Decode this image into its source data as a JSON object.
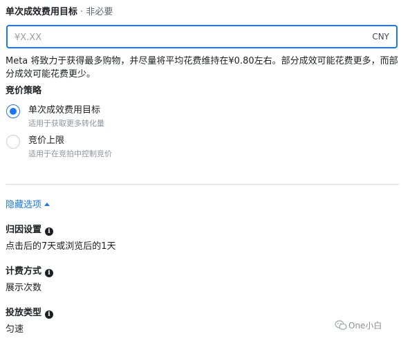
{
  "cost_goal": {
    "label": "单次成效费用目标",
    "optional_text": " · 非必要",
    "input_value": "",
    "placeholder": "¥X.XX",
    "currency": "CNY",
    "help_text": "Meta 将致力于获得最多购物，并尽量将平均花费维持在¥0.80左右。部分成效可能花费更多，而部分成效可能花费更少。"
  },
  "bid_strategy": {
    "title": "竞价策略",
    "options": [
      {
        "label": "单次成效费用目标",
        "description": "适用于获取更多转化量",
        "selected": true
      },
      {
        "label": "竞价上限",
        "description": "适用于在竞拍中控制竞价",
        "selected": false
      }
    ]
  },
  "hidden_options": {
    "toggle_label": "隐藏选项"
  },
  "settings": {
    "attribution": {
      "title": "归因设置",
      "value": "点击后的7天或浏览后的1天",
      "info_icon": "info-icon"
    },
    "billing": {
      "title": "计费方式",
      "value": "展示次数",
      "info_icon": "info-icon"
    },
    "delivery": {
      "title": "投放类型",
      "value": "匀速",
      "info_icon": "info-icon"
    }
  },
  "watermark": {
    "text": "One小白",
    "icon": "wechat-icon"
  },
  "colors": {
    "accent": "#1877f2",
    "text": "#1c1e21",
    "muted": "#8d949e",
    "divider": "#dadde1"
  }
}
